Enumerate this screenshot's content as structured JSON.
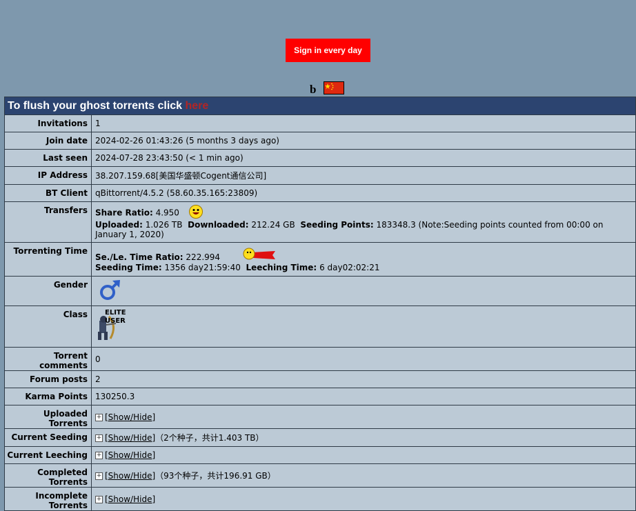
{
  "signin": {
    "label": "Sign in every day"
  },
  "user": {
    "name": "b"
  },
  "banner": {
    "prefix": "To flush your ghost torrents click ",
    "link": "here"
  },
  "rows": {
    "invitations": {
      "label": "Invitations",
      "value": "1"
    },
    "join_date": {
      "label": "Join date",
      "value": "2024-02-26 01:43:26 (5 months 3 days ago)"
    },
    "last_seen": {
      "label": "Last seen",
      "value": "2024-07-28 23:43:50 (< 1 min ago)"
    },
    "ip": {
      "label": "IP Address",
      "value": "38.207.159.68[美国华盛顿Cogent通信公司]"
    },
    "bt_client": {
      "label": "BT Client",
      "value": "qBittorrent/4.5.2 (58.60.35.165:23809)"
    },
    "transfers": {
      "label": "Transfers",
      "share_ratio_label": "Share Ratio:",
      "share_ratio": "4.950",
      "uploaded_label": "Uploaded:",
      "uploaded": "1.026 TB",
      "downloaded_label": "Downloaded:",
      "downloaded": "212.24 GB",
      "seeding_points_label": "Seeding Points:",
      "seeding_points": "183348.3 (Note:Seeding points counted from 00:00 on January 1, 2020)"
    },
    "torrenting_time": {
      "label": "Torrenting Time",
      "ratio_label": "Se./Le. Time Ratio:",
      "ratio": "222.994",
      "seeding_label": "Seeding Time:",
      "seeding": "1356 day21:59:40",
      "leeching_label": "Leeching Time:",
      "leeching": "6 day02:02:21"
    },
    "gender": {
      "label": "Gender"
    },
    "class": {
      "label": "Class",
      "badge_text_1": "ELITE",
      "badge_text_2": "USER"
    },
    "torrent_comments": {
      "label": "Torrent comments",
      "value": "0"
    },
    "forum_posts": {
      "label": "Forum posts",
      "value": "2"
    },
    "karma": {
      "label": "Karma Points",
      "value": "130250.3"
    },
    "uploaded_torrents": {
      "label": "Uploaded Torrents",
      "link": "[Show/Hide]",
      "extra": ""
    },
    "current_seeding": {
      "label": "Current Seeding",
      "link": "[Show/Hide]",
      "extra": "（2个种子，共计1.403 TB）"
    },
    "current_leeching": {
      "label": "Current Leeching",
      "link": "[Show/Hide]",
      "extra": ""
    },
    "completed_torrents": {
      "label": "Completed Torrents",
      "link": "[Show/Hide]",
      "extra": "（93个种子，共计196.91 GB）"
    },
    "incomplete_torrents": {
      "label": "Incomplete Torrents",
      "link": "[Show/Hide]",
      "extra": ""
    }
  },
  "colors": {
    "header_bg": "#2c4470",
    "row_bg": "#bccad6",
    "page_bg": "#7e98ad",
    "signin_bg": "#ff0000",
    "link_red": "#b32525"
  }
}
